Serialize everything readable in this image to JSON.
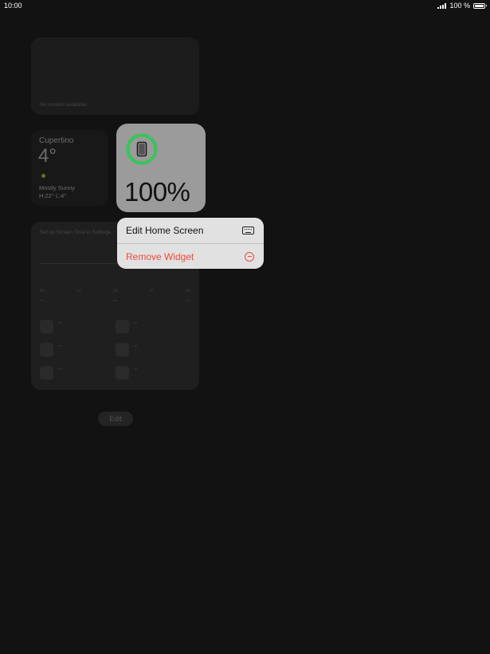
{
  "status_bar": {
    "time": "10:00",
    "battery_text": "100 %",
    "battery_level": 1.0
  },
  "widgets": {
    "empty": {
      "message": "No content available"
    },
    "weather": {
      "city": "Cupertino",
      "temperature": "4°",
      "condition": "Mostly Sunny",
      "hi_lo": "H:22° L:4°"
    },
    "screen_time": {
      "header": "Set up Screen Time in Settings",
      "axis_labels": [
        "6h",
        "12",
        "18",
        "00",
        "6h"
      ],
      "totals": [
        "--",
        "--",
        "--"
      ],
      "apps": [
        {
          "name": "--"
        },
        {
          "name": "--"
        },
        {
          "name": "--"
        },
        {
          "name": "--"
        },
        {
          "name": "--"
        },
        {
          "name": "--"
        }
      ]
    },
    "battery": {
      "percent": "100%",
      "level": 1.0,
      "ring_color": "#34c759"
    }
  },
  "edit_button": {
    "label": "Edit"
  },
  "context_menu": {
    "items": [
      {
        "label": "Edit Home Screen",
        "icon": "keyboard-icon"
      },
      {
        "label": "Remove Widget",
        "icon": "minus-circle-icon",
        "color": "#ef4a3d"
      }
    ]
  }
}
